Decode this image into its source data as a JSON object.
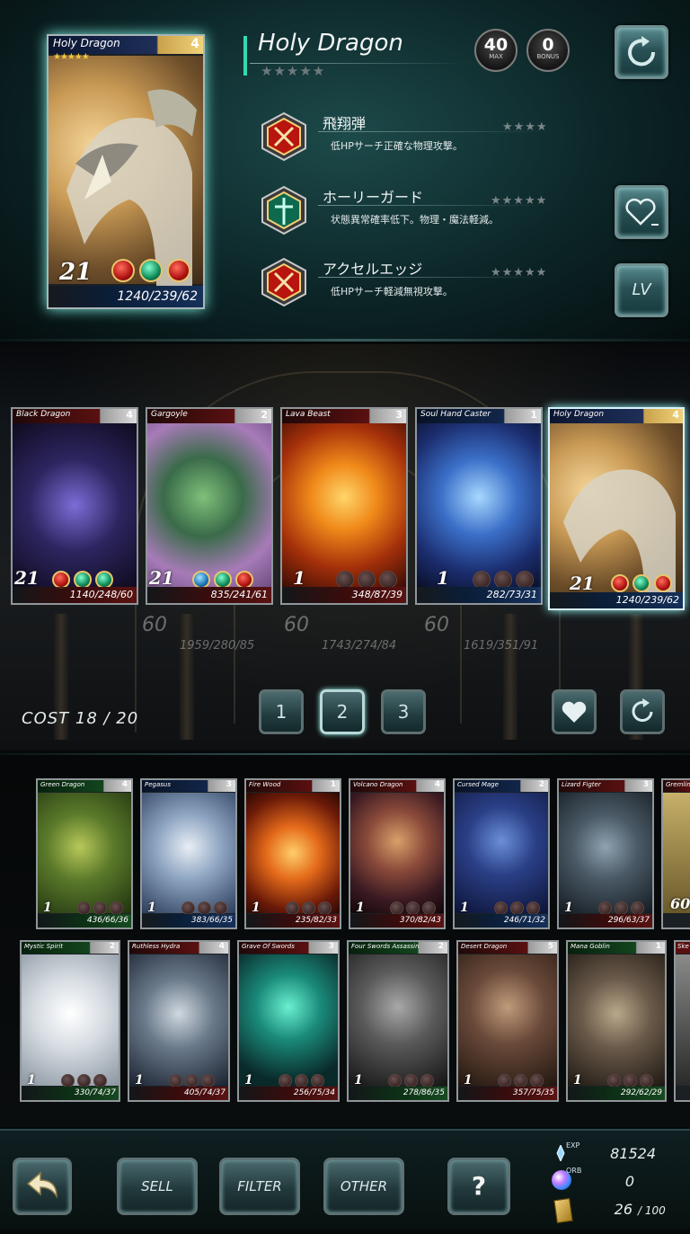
{
  "selected": {
    "name": "Holy Dragon",
    "cost": "4",
    "stars": "★★★★★",
    "title_stars": "★★★★★",
    "level": "21",
    "stats": "1240/239/62",
    "medal_left_value": "40",
    "medal_left_label": "MAX",
    "medal_right_value": "0",
    "medal_right_label": "BONUS",
    "skills": [
      {
        "name": "飛翔弾",
        "desc": "低HPサーチ正確な物理攻撃。",
        "stars": "★★★★",
        "icon": "sword-red-icon"
      },
      {
        "name": "ホーリーガード",
        "desc": "状態異常確率低下。物理・魔法軽減。",
        "stars": "★★★★★",
        "icon": "cross-green-icon"
      },
      {
        "name": "アクセルエッジ",
        "desc": "低HPサーチ軽減無視攻撃。",
        "stars": "★★★★★",
        "icon": "sword-red-icon"
      }
    ]
  },
  "side_buttons": {
    "refresh": "refresh-icon",
    "favorite": "heart-minus-icon",
    "lv": "LV"
  },
  "deck": {
    "cards": [
      {
        "name": "Black Dragon",
        "cost": "4",
        "level": "21",
        "stats": "1140/248/60"
      },
      {
        "name": "Gargoyle",
        "cost": "2",
        "level": "21",
        "stats": "835/241/61"
      },
      {
        "name": "Lava Beast",
        "cost": "3",
        "level": "1",
        "stats": "348/87/39"
      },
      {
        "name": "Soul Hand Caster",
        "cost": "1",
        "level": "1",
        "stats": "282/73/31"
      },
      {
        "name": "Holy Dragon",
        "cost": "4",
        "level": "21",
        "stats": "1240/239/62"
      }
    ],
    "ghost": [
      {
        "level": "60",
        "stats": "1959/280/85"
      },
      {
        "level": "60",
        "stats": "1743/274/84"
      },
      {
        "level": "60",
        "stats": "1619/351/91"
      }
    ],
    "cost_label": "COST 18 / 20",
    "pages": [
      "1",
      "2",
      "3"
    ]
  },
  "collection": {
    "row1": [
      {
        "name": "Green Dragon",
        "cost": "4",
        "level": "1",
        "stats": "436/66/36"
      },
      {
        "name": "Pegasus",
        "cost": "3",
        "level": "1",
        "stats": "383/66/35"
      },
      {
        "name": "Fire Wood",
        "cost": "1",
        "level": "1",
        "stats": "235/82/33"
      },
      {
        "name": "Volcano Dragon",
        "cost": "4",
        "level": "1",
        "stats": "370/82/43"
      },
      {
        "name": "Cursed Mage",
        "cost": "2",
        "level": "1",
        "stats": "246/71/32"
      },
      {
        "name": "Lizard Figter",
        "cost": "3",
        "level": "1",
        "stats": "296/63/37"
      },
      {
        "name": "Gremlin",
        "cost": "",
        "level": "60",
        "stats": ""
      }
    ],
    "row2": [
      {
        "name": "Mystic Spirit",
        "cost": "2",
        "level": "1",
        "stats": "330/74/37"
      },
      {
        "name": "Ruthless Hydra",
        "cost": "4",
        "level": "1",
        "stats": "405/74/37"
      },
      {
        "name": "Grave Of Swords",
        "cost": "3",
        "level": "1",
        "stats": "256/75/34"
      },
      {
        "name": "Four Swords Assassin",
        "cost": "2",
        "level": "1",
        "stats": "278/86/35"
      },
      {
        "name": "Desert Dragon",
        "cost": "5",
        "level": "1",
        "stats": "357/75/35"
      },
      {
        "name": "Mana Goblin",
        "cost": "1",
        "level": "1",
        "stats": "292/62/29"
      },
      {
        "name": "Ske",
        "cost": "",
        "level": "",
        "stats": ""
      }
    ]
  },
  "footer": {
    "back": "back-arrow-icon",
    "sell": "SELL",
    "filter": "FILTER",
    "other": "OTHER",
    "help": "?",
    "exp_label": "EXP",
    "exp": "81524",
    "orb_label": "ORB",
    "orb": "0",
    "cards": "26",
    "cards_max": "/ 100"
  },
  "colors": {
    "accent": "#34d8b3",
    "gold": "#f1c843",
    "panel": "#0c2527"
  }
}
